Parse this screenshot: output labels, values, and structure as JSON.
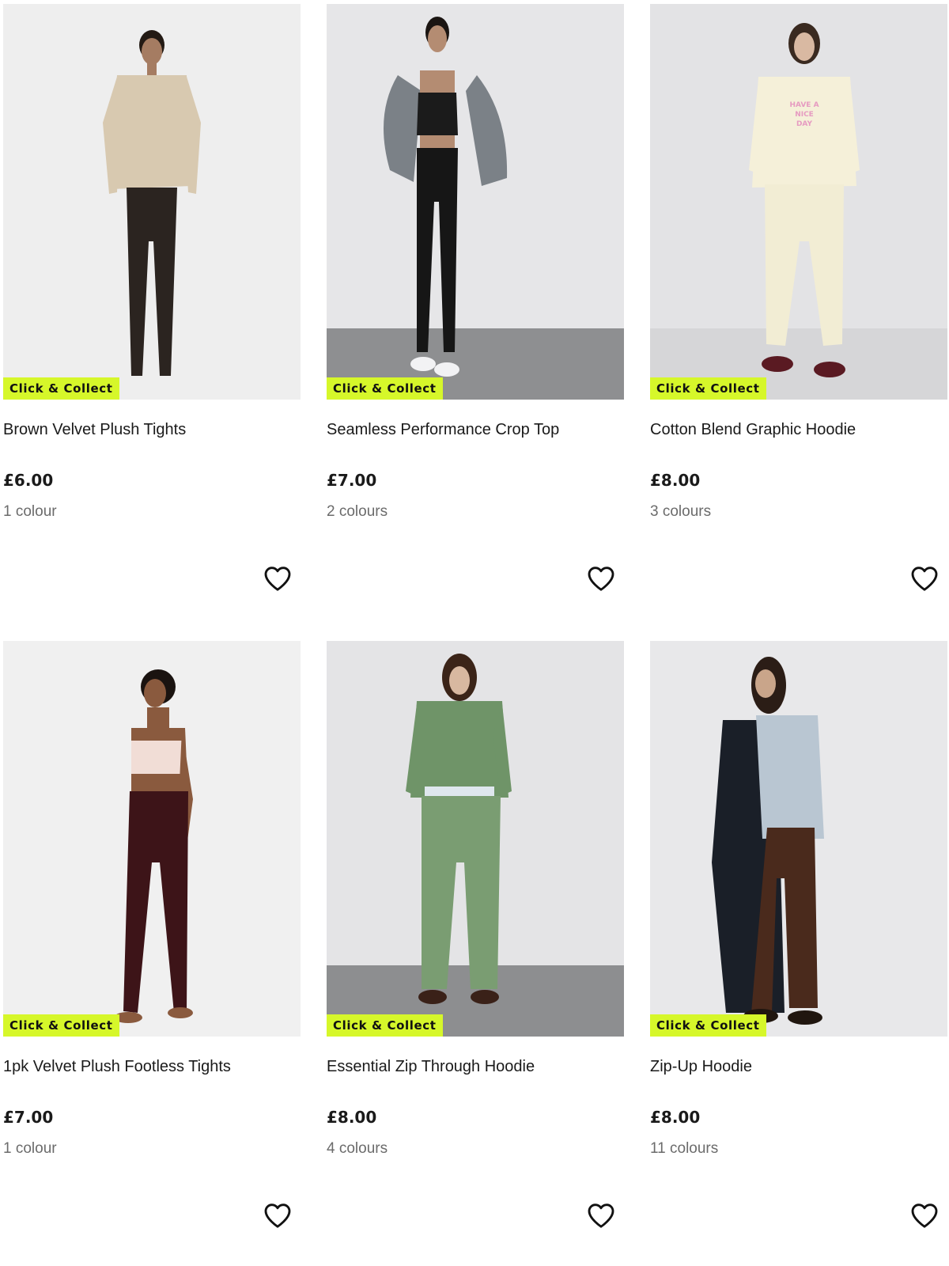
{
  "products": [
    {
      "name": "Brown Velvet Plush Tights",
      "price": "£6.00",
      "colours": "1 colour",
      "badge": "Click & Collect",
      "image": {
        "background": "#eeeeee",
        "floor": "#eeeeee",
        "top": "#d8c9b0",
        "bottom": "#2b2420",
        "skin": "#a57c62",
        "hair": "#231a14"
      }
    },
    {
      "name": "Seamless Performance Crop Top",
      "price": "£7.00",
      "colours": "2 colours",
      "badge": "Click & Collect",
      "image": {
        "background": "#e6e6e8",
        "floor": "#8e8f91",
        "top": "#1b1b1b",
        "bottom": "#161616",
        "skin": "#b48c72",
        "hair": "#1b1512",
        "accent": "#7b8187"
      }
    },
    {
      "name": "Cotton Blend Graphic Hoodie",
      "price": "£8.00",
      "colours": "3 colours",
      "badge": "Click & Collect",
      "image": {
        "background": "#e3e3e5",
        "floor": "#d6d6d8",
        "top": "#f5f0d9",
        "bottom": "#f2edd4",
        "skin": "#d9b9a2",
        "hair": "#3a2a20",
        "shoe": "#5a1a22"
      }
    },
    {
      "name": "1pk Velvet Plush Footless Tights",
      "price": "£7.00",
      "colours": "1 colour",
      "badge": "Click & Collect",
      "image": {
        "background": "#f0f0f0",
        "floor": "#f0f0f0",
        "top": "#f1ddd6",
        "bottom": "#3d1418",
        "skin": "#8a5a3e",
        "hair": "#1a1310"
      }
    },
    {
      "name": "Essential Zip Through Hoodie",
      "price": "£8.00",
      "colours": "4 colours",
      "badge": "Click & Collect",
      "image": {
        "background": "#e4e4e6",
        "floor": "#8d8e90",
        "top": "#6f9468",
        "bottom": "#7a9d72",
        "skin": "#d8b8a0",
        "hair": "#3b2418",
        "shoe": "#3a2118"
      }
    },
    {
      "name": "Zip-Up Hoodie",
      "price": "£8.00",
      "colours": "11 colours",
      "badge": "Click & Collect",
      "image": {
        "background": "#e8e8ea",
        "floor": "#e8e8ea",
        "top": "#b9c6d2",
        "bottom": "#4a2a1c",
        "skin": "#c9a58a",
        "hair": "#2b1d16",
        "coat": "#1a1f28",
        "shoe": "#20160f"
      }
    }
  ]
}
